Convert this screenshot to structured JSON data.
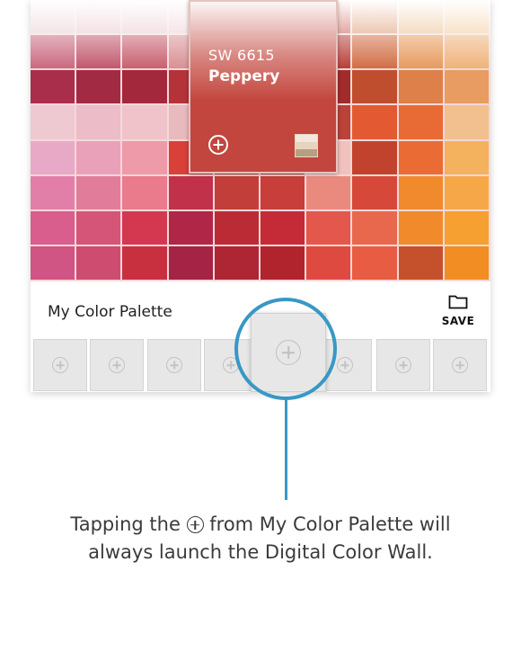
{
  "chip": {
    "number": "SW 6615",
    "name": "Peppery",
    "color": "#c2463d",
    "add_icon": "plus-circle-icon",
    "swatch_icon": "color-strip-icon"
  },
  "wall": {
    "rows": [
      [
        "#e7c7cd",
        "#e7bfc7",
        "#e9c2c9",
        "#ecc9cd",
        "#c9564b",
        "#c74c41",
        "#c4493d",
        "#d88a5f",
        "#e8b683",
        "#f0c48f"
      ],
      [
        "#c8657d",
        "#c0546a",
        "#c65c6c",
        "#d88d91",
        "#b93b35",
        "#b83a33",
        "#b63b34",
        "#d06a3f",
        "#e7985a",
        "#efb178"
      ],
      [
        "#a82e4b",
        "#a32a43",
        "#a4283b",
        "#b5323b",
        "#a9302f",
        "#a9302d",
        "#a12d2a",
        "#bf4e2f",
        "#dd8049",
        "#e89c62"
      ],
      [
        "#efc9d1",
        "#ecbcc8",
        "#f0c3cb",
        "#e8b9bd",
        "#c4453d",
        "#c2443b",
        "#b94239",
        "#e35a32",
        "#e86a35",
        "#f1c08e"
      ],
      [
        "#e8a9c6",
        "#e9a1ba",
        "#ee9aa9",
        "#d9403a",
        "#c2463d",
        "#c2463d",
        "#f1c2bd",
        "#c2432d",
        "#ea6c34",
        "#f4b15e"
      ],
      [
        "#e27fa8",
        "#e27c9b",
        "#e97b8c",
        "#c2314a",
        "#c23e3a",
        "#c73e3a",
        "#ea8a7f",
        "#d6493a",
        "#f08a2d",
        "#f6a848"
      ],
      [
        "#d95d8d",
        "#d55579",
        "#d43850",
        "#b02647",
        "#bb2b36",
        "#c42b36",
        "#e4574d",
        "#e8684e",
        "#f08a2b",
        "#f5a030"
      ],
      [
        "#d05484",
        "#cd4c6f",
        "#c9303f",
        "#a52344",
        "#ae2633",
        "#b1242e",
        "#df4a40",
        "#e85c44",
        "#c5512c",
        "#f28d23"
      ]
    ]
  },
  "palette": {
    "title": "My Color Palette",
    "save_label": "SAVE",
    "save_icon": "folder-icon",
    "slot_icon": "plus-circle-icon"
  },
  "caption": {
    "line1_before": "Tapping the",
    "line1_after": "from My Color Palette will",
    "line2": "always launch the Digital Color Wall."
  },
  "callout_color": "#3898c5"
}
